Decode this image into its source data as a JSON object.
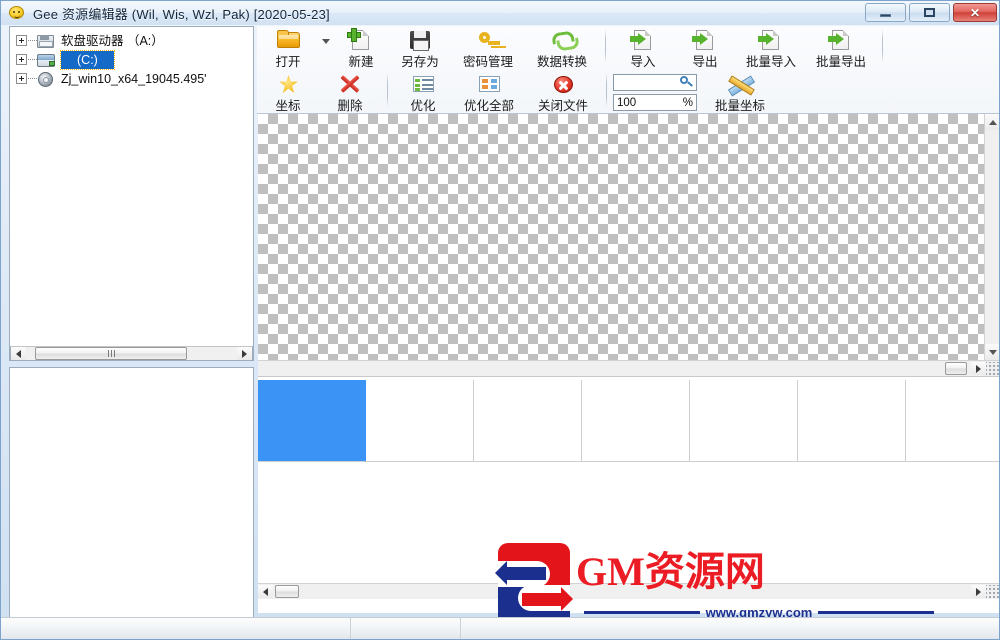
{
  "window": {
    "title": "Gee 资源编辑器 (Wil, Wis, Wzl, Pak) [2020-05-23]",
    "icon": "smiley-icon",
    "controls": {
      "minimize": "—",
      "maximize": "□",
      "close": "✕"
    }
  },
  "tree": {
    "items": [
      {
        "label": "软盘驱动器 （A:）",
        "icon": "floppy-drive-icon",
        "selected": false
      },
      {
        "label": "(C:)",
        "icon": "hard-drive-icon",
        "selected": true
      },
      {
        "label": "Zj_win10_x64_19045.495'",
        "icon": "cd-drive-icon",
        "selected": false
      }
    ]
  },
  "toolbar": {
    "row1": [
      {
        "label": "打开",
        "icon": "open-folder-icon",
        "type": "button"
      },
      {
        "label": "",
        "icon": "chevron-down-icon",
        "type": "caret"
      },
      {
        "label": "新建",
        "icon": "new-file-icon",
        "type": "button"
      },
      {
        "label": "另存为",
        "icon": "save-as-icon",
        "type": "button"
      },
      {
        "label": "密码管理",
        "icon": "key-icon",
        "type": "button"
      },
      {
        "label": "数据转换",
        "icon": "convert-icon",
        "type": "button"
      },
      {
        "label": "",
        "icon": "separator",
        "type": "sep"
      },
      {
        "label": "导入",
        "icon": "import-icon",
        "type": "button"
      },
      {
        "label": "导出",
        "icon": "export-icon",
        "type": "button"
      },
      {
        "label": "批量导入",
        "icon": "batch-import-icon",
        "type": "button"
      },
      {
        "label": "批量导出",
        "icon": "batch-export-icon",
        "type": "button"
      },
      {
        "label": "",
        "icon": "separator",
        "type": "sep"
      }
    ],
    "row2": [
      {
        "label": "坐标",
        "icon": "star-icon",
        "type": "button"
      },
      {
        "label": "删除",
        "icon": "delete-x-icon",
        "type": "button"
      },
      {
        "label": "",
        "icon": "separator",
        "type": "sep"
      },
      {
        "label": "优化",
        "icon": "optimize-icon",
        "type": "button"
      },
      {
        "label": "优化全部",
        "icon": "optimize-all-icon",
        "type": "button"
      },
      {
        "label": "关闭文件",
        "icon": "close-file-icon",
        "type": "button"
      },
      {
        "label": "",
        "icon": "separator",
        "type": "sep"
      },
      {
        "label": "批量坐标",
        "icon": "batch-coordinate-icon",
        "type": "button"
      }
    ],
    "search_field": {
      "value": "",
      "placeholder": "",
      "icon": "search-icon"
    },
    "zoom_field": {
      "value": "100",
      "suffix": "%"
    }
  },
  "canvas": {
    "background": "transparent-checkerboard",
    "checker_light": "#ffffff",
    "checker_dark": "#bfbfbf"
  },
  "thumbnails": {
    "selected_index": 0,
    "selected_color": "#3b94f5",
    "cells": [
      {
        "selected": true
      },
      {
        "selected": false
      },
      {
        "selected": false
      },
      {
        "selected": false
      },
      {
        "selected": false
      },
      {
        "selected": false
      },
      {
        "selected": false
      }
    ]
  },
  "statusbar": {
    "cells": [
      "",
      "",
      ""
    ]
  },
  "watermark": {
    "brand": "GM资源网",
    "url": "www.gmzyw.com",
    "red": "#ec1c24",
    "blue": "#1b2f8f"
  }
}
